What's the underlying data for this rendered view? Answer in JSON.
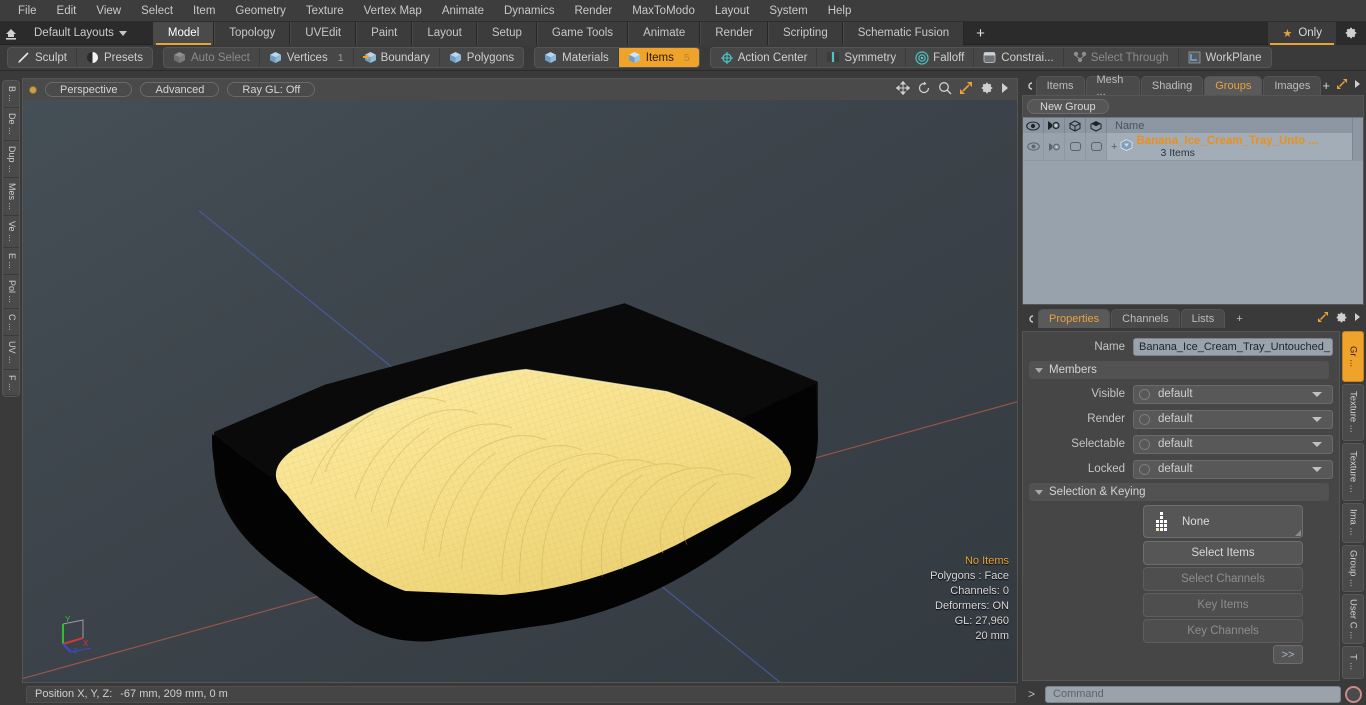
{
  "menubar": {
    "items": [
      "File",
      "Edit",
      "View",
      "Select",
      "Item",
      "Geometry",
      "Texture",
      "Vertex Map",
      "Animate",
      "Dynamics",
      "Render",
      "MaxToModo",
      "Layout",
      "System",
      "Help"
    ]
  },
  "layoutbar": {
    "home_icon": "home-icon",
    "layouts_label": "Default Layouts",
    "tabs": [
      {
        "label": "Model",
        "active": true
      },
      {
        "label": "Topology",
        "active": false
      },
      {
        "label": "UVEdit",
        "active": false
      },
      {
        "label": "Paint",
        "active": false
      },
      {
        "label": "Layout",
        "active": false
      },
      {
        "label": "Setup",
        "active": false
      },
      {
        "label": "Game Tools",
        "active": false
      },
      {
        "label": "Animate",
        "active": false
      },
      {
        "label": "Render",
        "active": false
      },
      {
        "label": "Scripting",
        "active": false
      },
      {
        "label": "Schematic Fusion",
        "active": false
      }
    ],
    "add_label": "+",
    "only_label": "Only",
    "gear_icon": "gear-icon"
  },
  "toolbar": {
    "groups": [
      {
        "buttons": [
          {
            "label": "Sculpt",
            "icon": "sculpt-brush-icon",
            "state": "normal",
            "count": ""
          },
          {
            "label": "Presets",
            "icon": "preset-sphere-icon",
            "state": "normal",
            "count": ""
          }
        ]
      },
      {
        "buttons": [
          {
            "label": "Auto Select",
            "icon": "cube-icon-grey",
            "state": "dim",
            "count": ""
          },
          {
            "label": "Vertices",
            "icon": "cube-icon-blue",
            "state": "normal",
            "count": "1"
          },
          {
            "label": "Boundary",
            "icon": "cube-icon-arrow",
            "state": "normal",
            "count": ""
          },
          {
            "label": "Polygons",
            "icon": "cube-icon-blue",
            "state": "normal",
            "count": ""
          }
        ]
      },
      {
        "buttons": [
          {
            "label": "Materials",
            "icon": "cube-icon-blue",
            "state": "normal",
            "count": ""
          },
          {
            "label": "Items",
            "icon": "cube-icon-orange",
            "state": "selected",
            "count": "5"
          }
        ]
      },
      {
        "buttons": [
          {
            "label": "Action Center",
            "icon": "target-icon",
            "state": "normal",
            "count": ""
          },
          {
            "label": "Symmetry",
            "icon": "symmetry-icon",
            "state": "normal",
            "count": ""
          },
          {
            "label": "Falloff",
            "icon": "falloff-icon",
            "state": "normal",
            "count": ""
          },
          {
            "label": "Constrai...",
            "icon": "constraint-icon",
            "state": "normal",
            "count": ""
          },
          {
            "label": "Select Through",
            "icon": "select-through-icon",
            "state": "dim",
            "count": ""
          },
          {
            "label": "WorkPlane",
            "icon": "workplane-icon",
            "state": "normal",
            "count": ""
          }
        ]
      }
    ]
  },
  "left_tabs": [
    "B ...",
    "De ...",
    "Dup ...",
    "Mes ...",
    "Ve ...",
    "E ...",
    "Pol ...",
    "C ...",
    "UV ...",
    "F ..."
  ],
  "viewport": {
    "header_pills": [
      "Perspective",
      "Advanced",
      "Ray GL: Off"
    ],
    "tool_icons": [
      "move-icon",
      "rotate-icon",
      "magnifier-icon",
      "fit-icon",
      "gear-icon",
      "arrow-right-icon"
    ],
    "stats": {
      "selection": "No Items",
      "polygons": "Polygons : Face",
      "channels": "Channels: 0",
      "deformers": "Deformers: ON",
      "gl": "GL: 27,960",
      "scale": "20 mm"
    },
    "axis_labels": {
      "x": "X",
      "y": "Y",
      "z": "Z"
    },
    "bg_color": "#3b4247",
    "model": {
      "tray_color": "#050505",
      "icecream_color": "#f6df81",
      "name": "Banana Ice Cream Tray"
    }
  },
  "group_panel": {
    "tabs": [
      {
        "label": "Items",
        "active": false
      },
      {
        "label": "Mesh ...",
        "active": false
      },
      {
        "label": "Shading",
        "active": false
      },
      {
        "label": "Groups",
        "active": true
      },
      {
        "label": "Images",
        "active": false
      }
    ],
    "add_label": "+",
    "new_group_label": "New Group",
    "columns": [
      "eye-icon",
      "render-icon",
      "lock-icon-1",
      "lock-icon-2",
      "Name"
    ],
    "rows": [
      {
        "name": "Banana_Ice_Cream_Tray_Unto ...",
        "sub": "3 Items"
      }
    ]
  },
  "properties": {
    "tabs": [
      {
        "label": "Properties",
        "active": true
      },
      {
        "label": "Channels",
        "active": false
      },
      {
        "label": "Lists",
        "active": false
      }
    ],
    "add_label": "+",
    "name_label": "Name",
    "name_value": "Banana_Ice_Cream_Tray_Untouched_",
    "members_section": "Members",
    "fields": [
      {
        "label": "Visible",
        "value": "default"
      },
      {
        "label": "Render",
        "value": "default"
      },
      {
        "label": "Selectable",
        "value": "default"
      },
      {
        "label": "Locked",
        "value": "default"
      }
    ],
    "selection_section": "Selection & Keying",
    "none_label": "None",
    "buttons": [
      {
        "label": "Select Items",
        "enabled": true
      },
      {
        "label": "Select Channels",
        "enabled": false
      },
      {
        "label": "Key Items",
        "enabled": false
      },
      {
        "label": "Key Channels",
        "enabled": false
      }
    ],
    "expand_label": ">>"
  },
  "right_tabs": [
    {
      "label": "Gr ...",
      "active": true
    },
    {
      "label": "Texture ...",
      "active": false
    },
    {
      "label": "Texture ...",
      "active": false
    },
    {
      "label": "Ima ...",
      "active": false
    },
    {
      "label": "Group ...",
      "active": false
    },
    {
      "label": "User C ...",
      "active": false
    },
    {
      "label": "T ...",
      "active": false
    }
  ],
  "bottombar": {
    "position_label": "Position X, Y, Z:",
    "position_value": "-67 mm, 209 mm, 0 m",
    "command_prefix": ">",
    "command_placeholder": "Command",
    "record_icon": "record-icon"
  },
  "colors": {
    "accent": "#e8a33d",
    "selected": "#f0a32a",
    "panel": "#4a4a4a",
    "list_bg": "#98a2ad"
  }
}
